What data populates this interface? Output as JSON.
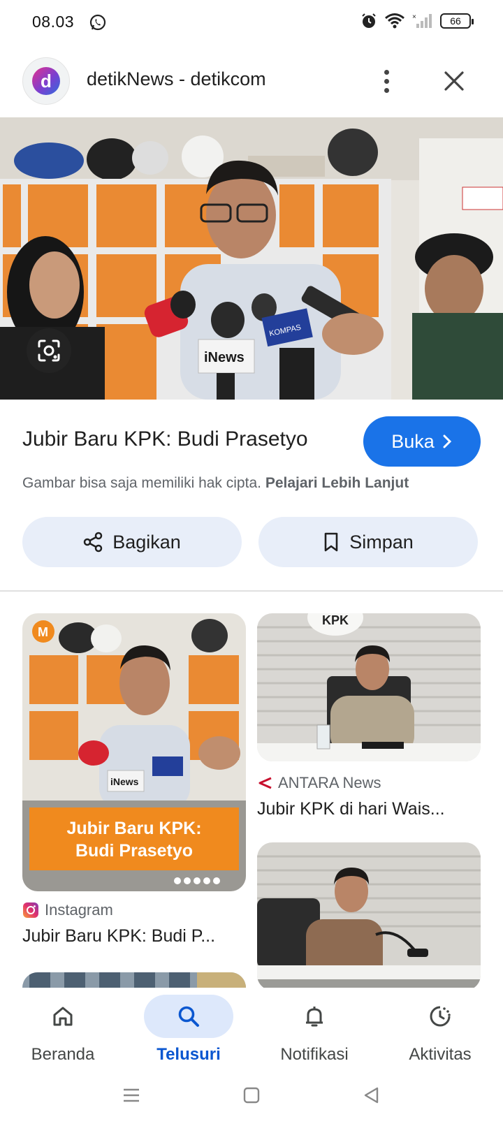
{
  "status_bar": {
    "time": "08.03",
    "battery": "66"
  },
  "header": {
    "site_title": "detikNews - detikcom",
    "logo_letter": "d"
  },
  "result": {
    "title": "Jubir Baru KPK: Budi Prasetyo",
    "open_label": "Buka",
    "copyright_text": "Gambar bisa saja memiliki hak cipta.",
    "learn_more": "Pelajari Lebih Lanjut",
    "share_label": "Bagikan",
    "save_label": "Simpan"
  },
  "related": [
    {
      "source": "Instagram",
      "caption": "Jubir Baru KPK: Budi P...",
      "image_text_1": "Jubir Baru KPK:",
      "image_text_2": "Budi Prasetyo"
    },
    {
      "source": "ANTARA News",
      "caption": "Jubir KPK di hari Wais..."
    },
    {
      "source": "",
      "caption": ""
    }
  ],
  "bottom_nav": [
    {
      "label": "Beranda",
      "icon": "home-icon"
    },
    {
      "label": "Telusuri",
      "icon": "search-icon"
    },
    {
      "label": "Notifikasi",
      "icon": "bell-icon"
    },
    {
      "label": "Aktivitas",
      "icon": "activity-icon"
    }
  ],
  "colors": {
    "accent": "#1a73e8",
    "active_nav": "#0b57d0",
    "chip_bg": "#e8eef9"
  }
}
